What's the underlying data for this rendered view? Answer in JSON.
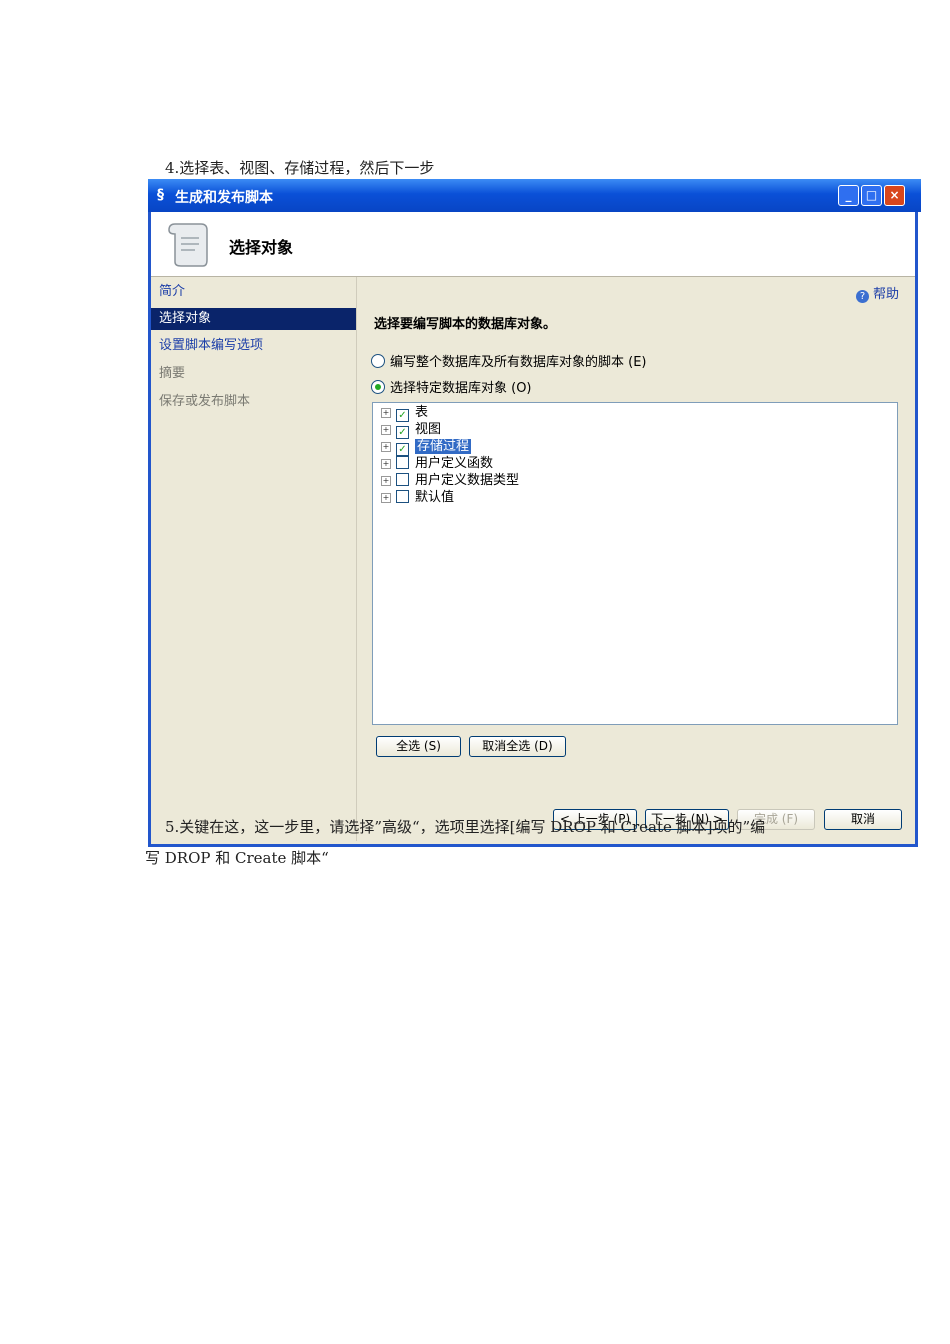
{
  "doc": {
    "step4": "4.选择表、视图、存储过程，然后下一步",
    "step5_line1": "5.关键在这，这一步里，请选择”高级“，选项里选择[编写 DROP 和 Create 脚本]项的”编",
    "step5_line2": "写 DROP 和 Create 脚本“"
  },
  "dialog": {
    "title": "生成和发布脚本",
    "header_title": "选择对象",
    "sidebar": [
      "简介",
      "选择对象",
      "设置脚本编写选项",
      "摘要",
      "保存或发布脚本"
    ],
    "help": "帮助",
    "heading": "选择要编写脚本的数据库对象。",
    "radio_all": "编写整个数据库及所有数据库对象的脚本 (E)",
    "radio_specific": "选择特定数据库对象 (O)",
    "tree": [
      {
        "label": "表",
        "checked": true
      },
      {
        "label": "视图",
        "checked": true
      },
      {
        "label": "存储过程",
        "checked": true
      },
      {
        "label": "用户定义函数",
        "checked": false
      },
      {
        "label": "用户定义数据类型",
        "checked": false
      },
      {
        "label": "默认值",
        "checked": false
      }
    ],
    "select_all": "全选 (S)",
    "deselect_all": "取消全选 (D)",
    "prev": "< 上一步 (P)",
    "next": "下一步 (N) >",
    "finish": "完成 (F)",
    "cancel": "取消"
  }
}
